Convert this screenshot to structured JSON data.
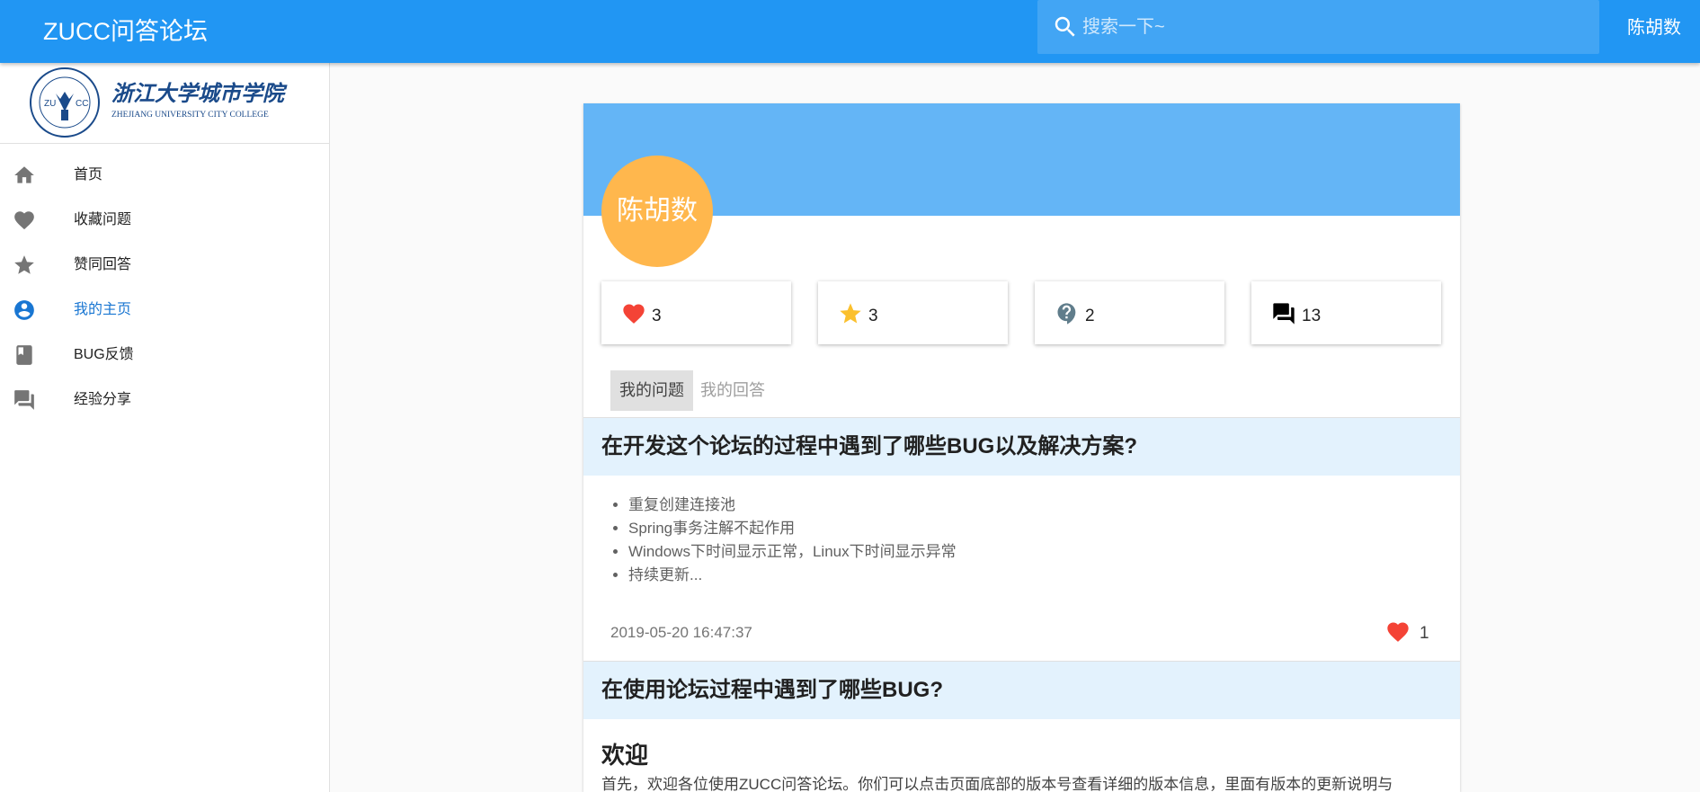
{
  "appbar": {
    "title": "ZUCC问答论坛",
    "search_placeholder": "搜索一下~",
    "user": "陈胡数",
    "color": "#2196f3"
  },
  "sidebar": {
    "logo_text": "浙江大学城市学院",
    "logo_subtext": "ZHEJIANG UNIVERSITY CITY COLLEGE",
    "items": [
      {
        "label": "首页",
        "icon": "home-icon"
      },
      {
        "label": "收藏问题",
        "icon": "heart-icon"
      },
      {
        "label": "赞同回答",
        "icon": "star-icon"
      },
      {
        "label": "我的主页",
        "icon": "account-circle-icon",
        "active": true
      },
      {
        "label": "BUG反馈",
        "icon": "book-icon"
      },
      {
        "label": "经验分享",
        "icon": "forum-icon"
      }
    ],
    "active_color": "#1976d2"
  },
  "profile": {
    "avatar_text": "陈胡数",
    "header_color": "#64b5f6",
    "avatar_color": "#ffb74d",
    "stats": [
      {
        "icon": "heart-icon",
        "value": "3",
        "color": "#f44336"
      },
      {
        "icon": "star-icon",
        "value": "3",
        "color": "#fbc02d"
      },
      {
        "icon": "question-icon",
        "value": "2",
        "color": "#607d8b"
      },
      {
        "icon": "forum-icon",
        "value": "13",
        "color": "#000000"
      }
    ]
  },
  "tabs": [
    "我的问题",
    "我的回答"
  ],
  "questions": [
    {
      "title": "在开发这个论坛的过程中遇到了哪些BUG以及解决方案?",
      "items": [
        "重复创建连接池",
        "Spring事务注解不起作用",
        "Windows下时间显示正常，Linux下时间显示异常",
        "持续更新..."
      ],
      "date": "2019-05-20 16:47:37",
      "likes": "1"
    },
    {
      "title": "在使用论坛过程中遇到了哪些BUG?",
      "heading": "欢迎",
      "body": "首先，欢迎各位使用ZUCC问答论坛。你们可以点击页面底部的版本号查看详细的版本信息，里面有版本的更新说明与"
    }
  ]
}
